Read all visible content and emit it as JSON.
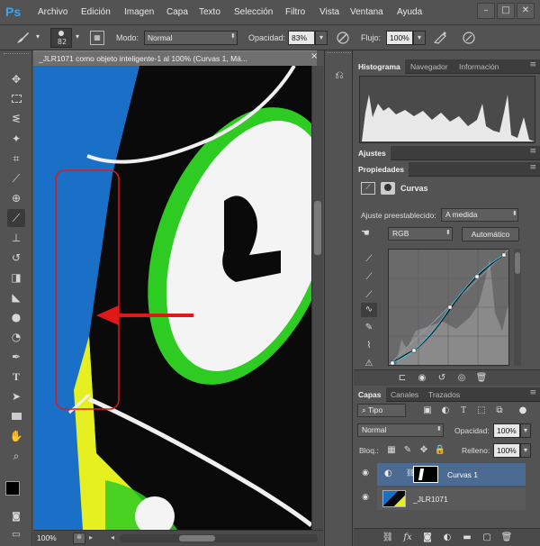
{
  "app": {
    "logo": "Ps"
  },
  "menu": [
    "Archivo",
    "Edición",
    "Imagen",
    "Capa",
    "Texto",
    "Selección",
    "Filtro",
    "Vista",
    "Ventana",
    "Ayuda"
  ],
  "window_buttons": {
    "minimize": "–",
    "maximize": "□",
    "close": "✕"
  },
  "options": {
    "brush_size": "82",
    "mode_label": "Modo:",
    "mode_value": "Normal",
    "opacity_label": "Opacidad:",
    "opacity_value": "83%",
    "flow_label": "Flujo:",
    "flow_value": "100%"
  },
  "document": {
    "tab_title": "_JLR1071 como objeto inteligente-1 al 100% (Curvas 1, Má...",
    "tab_close": "×",
    "zoom": "100%"
  },
  "panels": {
    "top_tabs": [
      "Histograma",
      "Navegador",
      "Información"
    ],
    "adjust_tab": "Ajustes",
    "props_tab": "Propiedades",
    "props_title": "Curvas",
    "preset_label": "Ajuste preestablecido:",
    "preset_value": "A medida",
    "channel_value": "RGB",
    "auto_button": "Automático",
    "layer_tabs": [
      "Capas",
      "Canales",
      "Trazados"
    ],
    "filter_value": "Tipo",
    "blend_value": "Normal",
    "opacity_label": "Opacidad:",
    "opacity_value": "100%",
    "lock_label": "Bloq.:",
    "fill_label": "Relleno:",
    "fill_value": "100%",
    "layers": [
      {
        "name": "Curvas 1"
      },
      {
        "name": "_JLR1071"
      }
    ]
  },
  "colors": {
    "sky": "#1a6fc7",
    "kite_green": "#2ecc22",
    "kite_yellow": "#e6f021",
    "arrow_red": "#e01818",
    "selection_layer": "#4c6b93",
    "ps_blue": "#31a8ff"
  }
}
